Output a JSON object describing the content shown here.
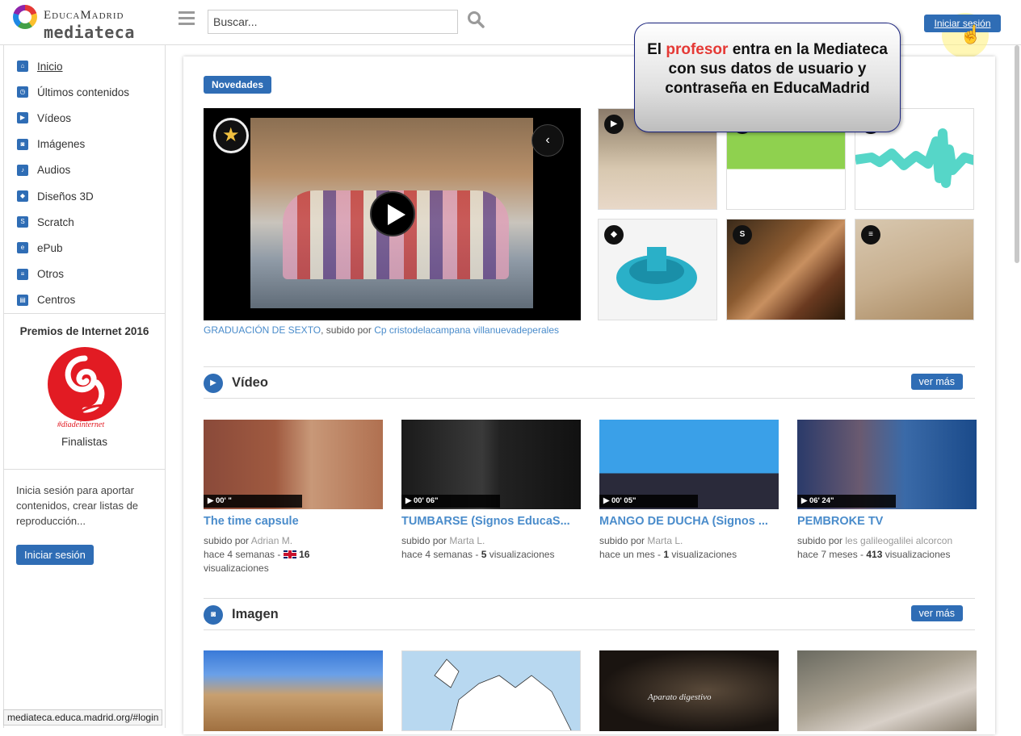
{
  "header": {
    "brand": "EducaMadrid",
    "product": "mediateca",
    "search_placeholder": "Buscar...",
    "login_label": "Iniciar sesión"
  },
  "sidebar": {
    "items": [
      {
        "label": "Inicio",
        "icon": "home-icon"
      },
      {
        "label": "Últimos contenidos",
        "icon": "clock-icon"
      },
      {
        "label": "Vídeos",
        "icon": "play-icon"
      },
      {
        "label": "Imágenes",
        "icon": "camera-icon"
      },
      {
        "label": "Audios",
        "icon": "speaker-icon"
      },
      {
        "label": "Diseños 3D",
        "icon": "cube-icon"
      },
      {
        "label": "Scratch",
        "icon": "scratch-icon"
      },
      {
        "label": "ePub",
        "icon": "book-icon"
      },
      {
        "label": "Otros",
        "icon": "document-icon"
      },
      {
        "label": "Centros",
        "icon": "building-icon"
      }
    ],
    "awards_title": "Premios de Internet 2016",
    "awards_logo_text": "#diadeinternet",
    "finalists": "Finalistas",
    "login_prompt": "Inicia sesión para aportar contenidos, crear listas de reproducción...",
    "login_button": "Iniciar sesión"
  },
  "main": {
    "novedades": "Novedades",
    "featured_title": "GRADUACIÓN DE SEXTO",
    "featured_uploaded_by": ", subido por ",
    "featured_author": "Cp cristodelacampana villanuevadeperales",
    "video_section": {
      "title": "Vídeo",
      "more": "ver más",
      "cards": [
        {
          "duration": "00' \"",
          "title": "The time capsule",
          "by": "subido por ",
          "author": "Adrian M.",
          "age": "hace 4 semanas - ",
          "views": "16",
          "views_label": " visualizaciones"
        },
        {
          "duration": "00' 06\"",
          "title": "TUMBARSE (Signos EducaS...",
          "by": "subido por ",
          "author": "Marta L.",
          "age": "hace 4 semanas - ",
          "views": "5",
          "views_label": " visualizaciones"
        },
        {
          "duration": "00' 05\"",
          "title": "MANGO DE DUCHA (Signos ...",
          "by": "subido por ",
          "author": "Marta L.",
          "age": "hace un mes - ",
          "views": "1",
          "views_label": " visualizaciones"
        },
        {
          "duration": "06' 24\"",
          "title": "PEMBROKE TV",
          "by": "subido por ",
          "author": "les galileogalilei alcorcon",
          "age": "hace 7 meses - ",
          "views": "413",
          "views_label": " visualizaciones"
        }
      ]
    },
    "image_section": {
      "title": "Imagen",
      "more": "ver más",
      "thumb3_text": "Aparato digestivo"
    }
  },
  "callout": {
    "part1": "El ",
    "highlight": "profesor",
    "part2": " entra en la Mediateca con sus datos de usuario y contraseña en EducaMadrid"
  },
  "status_url": "mediateca.educa.madrid.org/#login",
  "colors": {
    "accent": "#2f6db5",
    "link": "#4a8ccb",
    "callout_highlight": "#e53935"
  }
}
